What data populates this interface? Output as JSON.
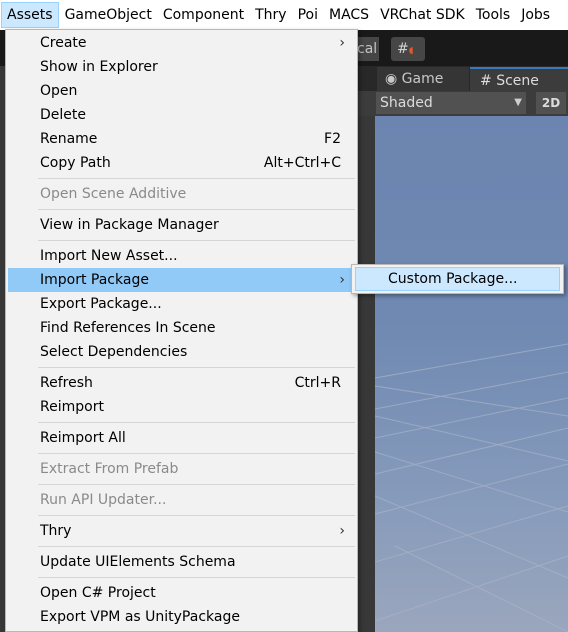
{
  "menubar": [
    "Assets",
    "GameObject",
    "Component",
    "Thry",
    "Poi",
    "MACS",
    "VRChat SDK",
    "Tools",
    "Jobs"
  ],
  "editor": {
    "toolbar_text": "cal",
    "tabs": {
      "game": "Game",
      "scene": "Scene"
    },
    "shading_mode": "Shaded",
    "mode_2d": "2D"
  },
  "assets_menu": {
    "items": [
      {
        "label": "Create",
        "shortcut": "",
        "submenu": true,
        "disabled": false
      },
      {
        "label": "Show in Explorer",
        "shortcut": "",
        "submenu": false,
        "disabled": false
      },
      {
        "label": "Open",
        "shortcut": "",
        "submenu": false,
        "disabled": false
      },
      {
        "label": "Delete",
        "shortcut": "",
        "submenu": false,
        "disabled": false
      },
      {
        "label": "Rename",
        "shortcut": "F2",
        "submenu": false,
        "disabled": false
      },
      {
        "label": "Copy Path",
        "shortcut": "Alt+Ctrl+C",
        "submenu": false,
        "disabled": false
      },
      {
        "label": "Open Scene Additive",
        "shortcut": "",
        "submenu": false,
        "disabled": true
      },
      {
        "label": "View in Package Manager",
        "shortcut": "",
        "submenu": false,
        "disabled": false
      },
      {
        "label": "Import New Asset...",
        "shortcut": "",
        "submenu": false,
        "disabled": false
      },
      {
        "label": "Import Package",
        "shortcut": "",
        "submenu": true,
        "disabled": false,
        "highlighted": true
      },
      {
        "label": "Export Package...",
        "shortcut": "",
        "submenu": false,
        "disabled": false
      },
      {
        "label": "Find References In Scene",
        "shortcut": "",
        "submenu": false,
        "disabled": false
      },
      {
        "label": "Select Dependencies",
        "shortcut": "",
        "submenu": false,
        "disabled": false
      },
      {
        "label": "Refresh",
        "shortcut": "Ctrl+R",
        "submenu": false,
        "disabled": false
      },
      {
        "label": "Reimport",
        "shortcut": "",
        "submenu": false,
        "disabled": false
      },
      {
        "label": "Reimport All",
        "shortcut": "",
        "submenu": false,
        "disabled": false
      },
      {
        "label": "Extract From Prefab",
        "shortcut": "",
        "submenu": false,
        "disabled": true
      },
      {
        "label": "Run API Updater...",
        "shortcut": "",
        "submenu": false,
        "disabled": true
      },
      {
        "label": "Thry",
        "shortcut": "",
        "submenu": true,
        "disabled": false
      },
      {
        "label": "Update UIElements Schema",
        "shortcut": "",
        "submenu": false,
        "disabled": false
      },
      {
        "label": "Open C# Project",
        "shortcut": "",
        "submenu": false,
        "disabled": false
      },
      {
        "label": "Export VPM as UnityPackage",
        "shortcut": "",
        "submenu": false,
        "disabled": false
      }
    ]
  },
  "import_package_submenu": {
    "items": [
      {
        "label": "Custom Package..."
      }
    ]
  },
  "colors": {
    "highlight": "#91c9f7",
    "menubar_active": "#cce8ff",
    "scene_sky": "#6f89b2"
  }
}
